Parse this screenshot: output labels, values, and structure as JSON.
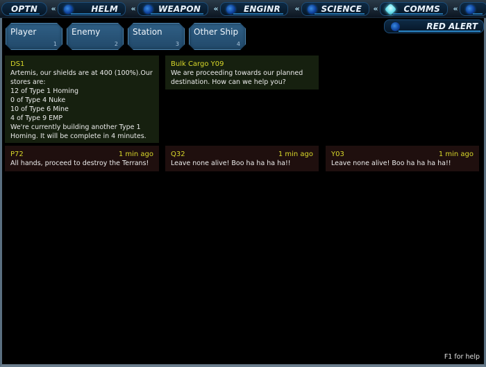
{
  "stations": [
    {
      "id": "optn",
      "label": "OPTN",
      "active": false
    },
    {
      "id": "helm",
      "label": "HELM",
      "active": false
    },
    {
      "id": "weapon",
      "label": "WEAPON",
      "active": false
    },
    {
      "id": "enginr",
      "label": "ENGINR",
      "active": false
    },
    {
      "id": "science",
      "label": "SCIENCE",
      "active": false
    },
    {
      "id": "comms",
      "label": "COMMS",
      "active": true
    }
  ],
  "red_alert_label": "RED ALERT",
  "target_tabs": [
    {
      "label": "Player",
      "hotkey": "1"
    },
    {
      "label": "Enemy",
      "hotkey": "2"
    },
    {
      "label": "Station",
      "hotkey": "3"
    },
    {
      "label": "Other Ship",
      "hotkey": "4"
    }
  ],
  "friendly_messages": [
    {
      "from": "DS1",
      "lines": [
        "Artemis, our shields are at 400 (100%).Our",
        "stores are:",
        "12  of  Type 1 Homing",
        "0  of  Type 4 Nuke",
        "10  of  Type 6 Mine",
        "4  of  Type 9 EMP",
        "We're currently building another Type 1",
        "Homing.  It will be complete in 4 minutes."
      ]
    },
    {
      "from": "Bulk Cargo Y09",
      "lines": [
        "We are proceeding towards our planned",
        "destination.  How can we help you?"
      ]
    }
  ],
  "enemy_messages": [
    {
      "from": "P72",
      "time": "1 min ago",
      "text": "All hands, proceed to destroy the Terrans!"
    },
    {
      "from": "Q32",
      "time": "1 min ago",
      "text": "Leave none alive!   Boo ha ha ha ha!!"
    },
    {
      "from": "Y03",
      "time": "1 min ago",
      "text": "Leave none alive!   Boo ha ha ha ha!!"
    }
  ],
  "help_text": "F1 for help",
  "colors": {
    "sender_yellow": "#d8d82a",
    "friendly_bg": "#16200f",
    "enemy_bg": "#1f0f0e",
    "tab_blue": "#2f5f85",
    "accent_cyan": "#6fe2ef"
  }
}
